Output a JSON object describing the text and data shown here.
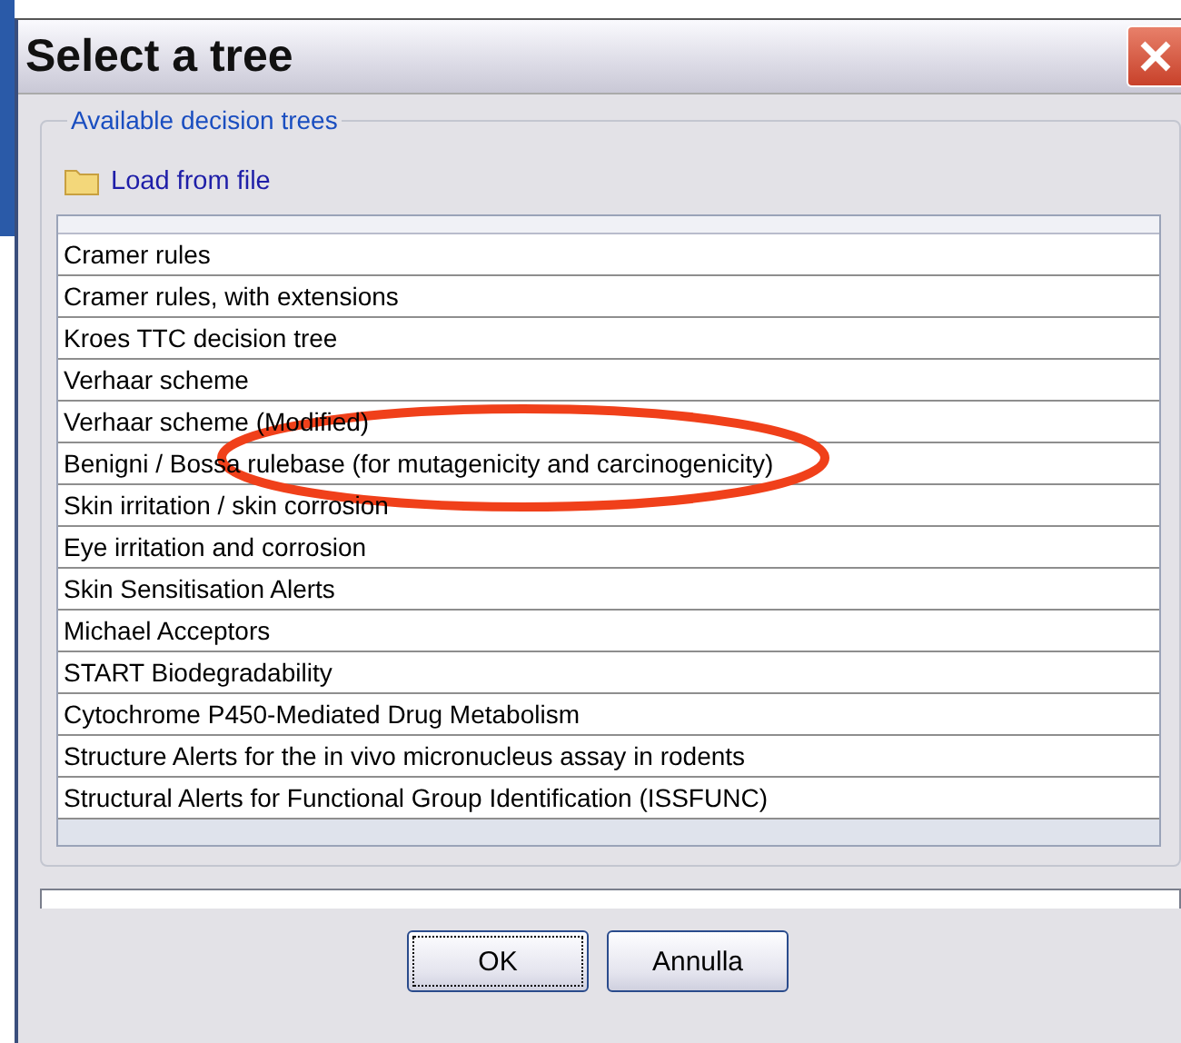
{
  "window": {
    "title": "Select a tree"
  },
  "group": {
    "legend": "Available decision trees",
    "load_button": "Load from file"
  },
  "trees": [
    {
      "label": "Cramer rules",
      "selected": false
    },
    {
      "label": "Cramer rules, with extensions",
      "selected": false
    },
    {
      "label": "Kroes TTC decision tree",
      "selected": false
    },
    {
      "label": "Verhaar scheme",
      "selected": false
    },
    {
      "label": "Verhaar scheme (Modified)",
      "selected": false
    },
    {
      "label": "Benigni / Bossa rulebase (for mutagenicity and carcinogenicity)",
      "selected": false
    },
    {
      "label": "Skin irritation / skin corrosion",
      "selected": false
    },
    {
      "label": "Eye irritation and corrosion",
      "selected": false
    },
    {
      "label": "Skin Sensitisation Alerts",
      "selected": false
    },
    {
      "label": "Michael Acceptors",
      "selected": false
    },
    {
      "label": "START Biodegradability",
      "selected": false
    },
    {
      "label": "Cytochrome P450-Mediated Drug Metabolism",
      "selected": false
    },
    {
      "label": "Structure Alerts for the in vivo micronucleus assay in rodents",
      "selected": false
    },
    {
      "label": "Structural Alerts for Functional Group Identification (ISSFUNC)",
      "selected": false
    }
  ],
  "buttons": [
    {
      "label": "OK",
      "focused": true
    },
    {
      "label": "Annulla",
      "focused": false
    }
  ]
}
